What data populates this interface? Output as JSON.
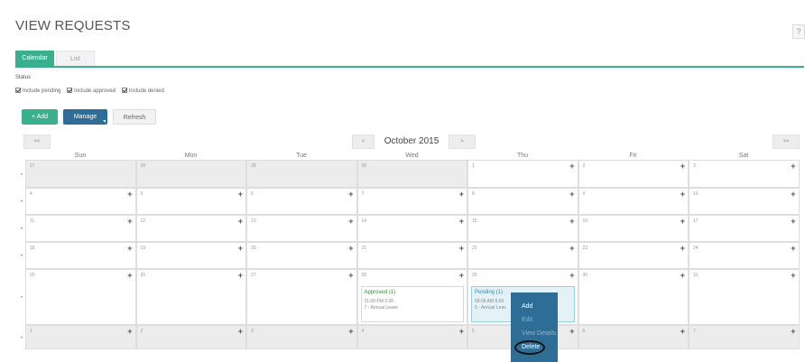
{
  "page": {
    "title": "VIEW REQUESTS",
    "help_label": "?"
  },
  "tabs": [
    {
      "label": "Calendar",
      "active": true
    },
    {
      "label": "List",
      "active": false
    }
  ],
  "filters": {
    "status_label": "Status",
    "options": [
      {
        "label": "Include pending",
        "checked": true
      },
      {
        "label": "Include approved",
        "checked": true
      },
      {
        "label": "Include denied",
        "checked": true
      }
    ]
  },
  "toolbar": {
    "add_label": "+ Add",
    "manage_label": "Manage",
    "refresh_label": "Refresh"
  },
  "calendar": {
    "month_title": "October 2015",
    "prev_far": "<<",
    "next_far": ">>",
    "prev": "<",
    "next": ">",
    "weekdays": [
      "Sun",
      "Mon",
      "Tue",
      "Wed",
      "Thu",
      "Fri",
      "Sat"
    ],
    "plus": "+",
    "weeks": [
      [
        "27",
        "28",
        "29",
        "30",
        "1",
        "2",
        "3"
      ],
      [
        "4",
        "5",
        "6",
        "7",
        "8",
        "9",
        "10"
      ],
      [
        "11",
        "12",
        "13",
        "14",
        "15",
        "16",
        "17"
      ],
      [
        "18",
        "19",
        "20",
        "21",
        "22",
        "23",
        "24"
      ],
      [
        "25",
        "26",
        "27",
        "28",
        "29",
        "30",
        "31"
      ],
      [
        "1",
        "2",
        "3",
        "4",
        "5",
        "6",
        "7"
      ]
    ],
    "events": {
      "approved": {
        "title": "Approved (1)",
        "line1": "01:00 PM 3.00",
        "line2": "7 - Annual Leave"
      },
      "pending": {
        "title": "Pending (1)",
        "line1": "08:00 AM 8.00",
        "line2": "5 - Annual Leav"
      }
    }
  },
  "context_menu": {
    "items": [
      {
        "label": "Add",
        "enabled": true
      },
      {
        "label": "Edit",
        "enabled": false
      },
      {
        "label": "View Details",
        "enabled": false
      },
      {
        "label": "Delete",
        "enabled": true
      }
    ]
  },
  "colors": {
    "accent": "#3bb08f",
    "manage": "#2e6e96",
    "approved_text": "#3a8a3a",
    "pending_bg": "#e4f2f7"
  }
}
